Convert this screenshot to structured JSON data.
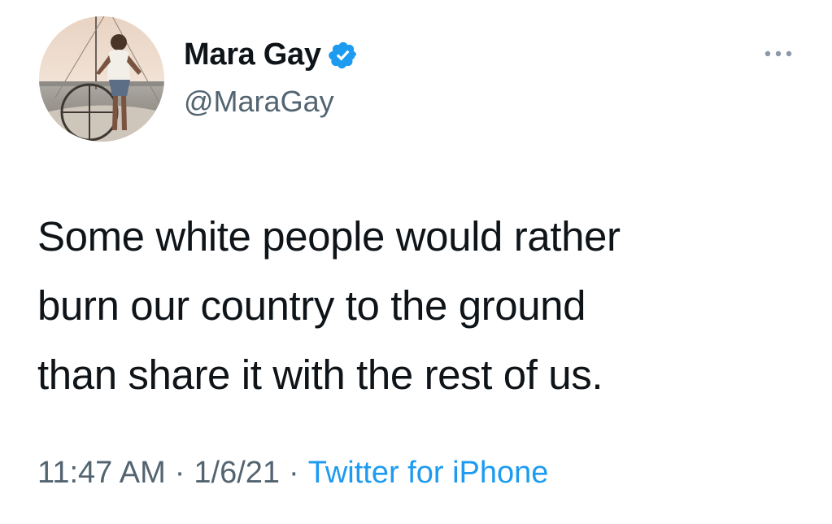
{
  "author": {
    "display_name": "Mara Gay",
    "handle": "@MaraGay",
    "verified": true
  },
  "tweet": {
    "text": "Some white people would rather\nburn our country to the ground\nthan share it with the rest of us."
  },
  "meta": {
    "time": "11:47 AM",
    "separator": "·",
    "date": "1/6/21",
    "source": "Twitter for iPhone"
  },
  "icons": {
    "verified": "verified-badge-icon",
    "more": "more-options-icon"
  },
  "colors": {
    "text": "#0f1419",
    "secondary": "#536471",
    "accent": "#1d9bf0"
  }
}
